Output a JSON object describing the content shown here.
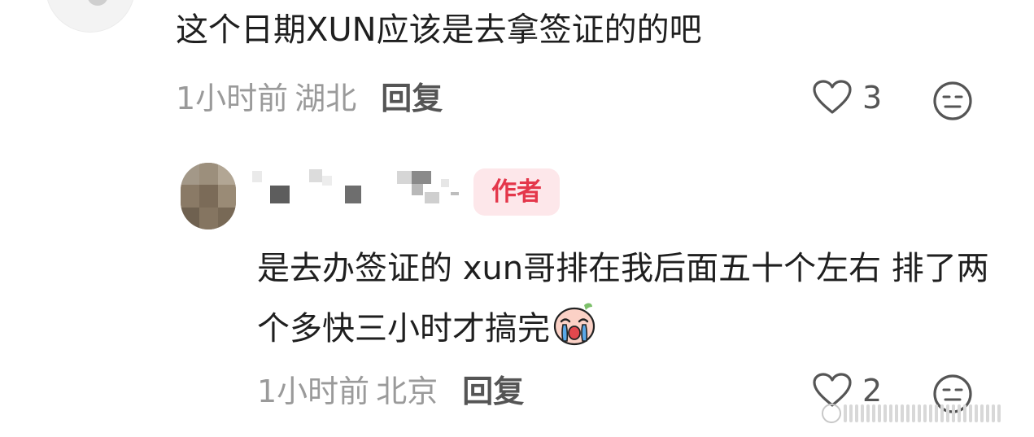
{
  "comment1": {
    "text": "这个日期XUN应该是去拿签证的的吧",
    "time": "1小时前",
    "location": "湖北",
    "reply_label": "回复",
    "like_count": "3",
    "like_icon": "heart-icon",
    "reaction_icon": "face-icon"
  },
  "comment2": {
    "author_badge": "作者",
    "text": "是去办签证的 xun哥排在我后面五十个左右 排了两个多快三小时才搞完",
    "emoji": "crying-peach-emoji",
    "time": "1小时前",
    "location": "北京",
    "reply_label": "回复",
    "like_count": "2",
    "like_icon": "heart-icon",
    "reaction_icon": "face-icon"
  },
  "colors": {
    "badge_bg": "#fde7ea",
    "badge_text": "#e4374b",
    "meta_text": "#9a9a9a"
  }
}
